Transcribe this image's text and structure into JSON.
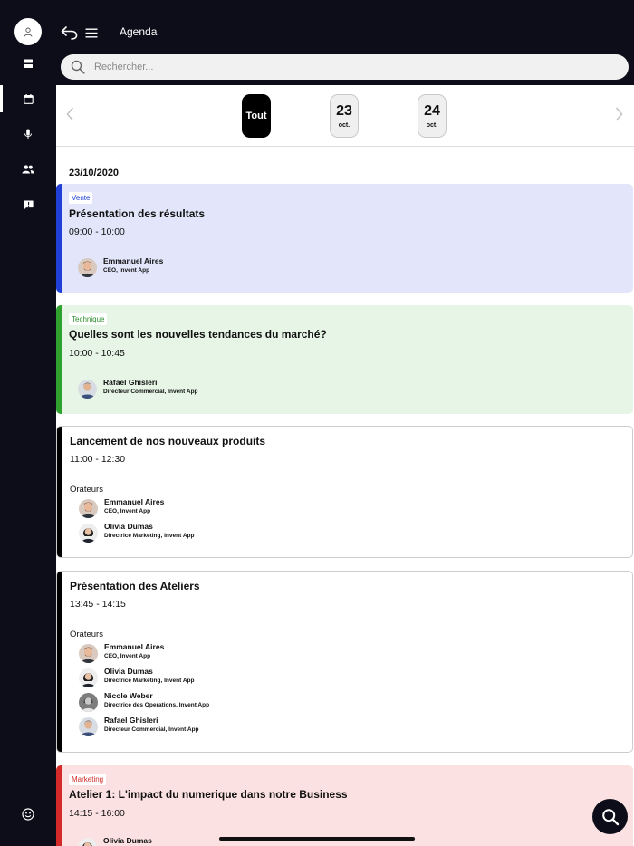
{
  "header": {
    "title": "Agenda"
  },
  "search": {
    "placeholder": "Rechercher..."
  },
  "datebar": {
    "all_label": "Tout",
    "days": [
      {
        "num": "23",
        "month": "oct."
      },
      {
        "num": "24",
        "month": "oct."
      }
    ]
  },
  "agenda": {
    "date": "23/10/2020",
    "orateurs_label": "Orateurs",
    "events": [
      {
        "tag": "Vente",
        "title": "Présentation des résultats",
        "time": "09:00 - 10:00",
        "speakers": [
          {
            "name": "Emmanuel Aires",
            "role": "CEO, Invent App"
          }
        ]
      },
      {
        "tag": "Technique",
        "title": "Quelles sont les nouvelles tendances du marché?",
        "time": "10:00 - 10:45",
        "speakers": [
          {
            "name": "Rafael Ghisleri",
            "role": "Directeur Commercial, Invent App"
          }
        ]
      },
      {
        "tag": "",
        "title": "Lancement de nos nouveaux produits",
        "time": "11:00 - 12:30",
        "speakers": [
          {
            "name": "Emmanuel Aires",
            "role": "CEO, Invent App"
          },
          {
            "name": "Olivia Dumas",
            "role": "Directrice Marketing, Invent App"
          }
        ]
      },
      {
        "tag": "",
        "title": "Présentation des Ateliers",
        "time": "13:45 - 14:15",
        "speakers": [
          {
            "name": "Emmanuel Aires",
            "role": "CEO, Invent App"
          },
          {
            "name": "Olivia Dumas",
            "role": "Directrice Marketing, Invent App"
          },
          {
            "name": "Nicole Weber",
            "role": "Directrice des Operations, Invent App"
          },
          {
            "name": "Rafael Ghisleri",
            "role": "Directeur Commercial, Invent App"
          }
        ]
      },
      {
        "tag": "Marketing",
        "title": "Atelier 1: L'impact du numerique dans notre Business",
        "time": "14:15 - 16:00",
        "speakers": [
          {
            "name": "Olivia Dumas",
            "role": ""
          }
        ]
      }
    ]
  },
  "colors": {
    "dark": "#0d0d1a",
    "vente_bg": "#e3e6fb",
    "vente_bar": "#1f3fd6",
    "vente_text": "#1f3fd6",
    "technique_bg": "#e6f5e6",
    "technique_bar": "#2fa12f",
    "technique_text": "#2b8f2b",
    "marketing_bg": "#fbe1e1",
    "marketing_bar": "#d42a2a",
    "marketing_text": "#d42a2a",
    "plain_bar": "#000000"
  },
  "icons": {
    "sidebar": [
      "user-icon",
      "dashboard-icon",
      "calendar-icon",
      "microphone-icon",
      "people-icon",
      "feedback-icon",
      "logout-icon"
    ],
    "header": [
      "back-icon",
      "menu-icon",
      "search-icon"
    ],
    "fab": "search-icon"
  }
}
